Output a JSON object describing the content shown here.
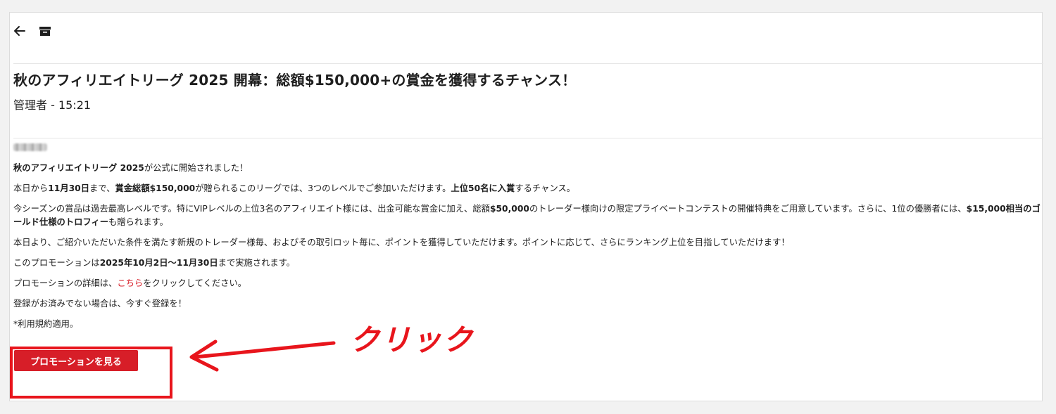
{
  "toolbar": {
    "back_icon": "arrow-left-icon",
    "archive_icon": "archive-box-icon"
  },
  "message": {
    "title": "秋のアフィリエイトリーグ 2025 開幕：総額$150,000+の賞金を獲得するチャンス！",
    "meta": "管理者 - 15:21",
    "paragraphs": {
      "p1_b1": "秋のアフィリエイトリーグ 2025",
      "p1_t1": "が公式に開始されました！",
      "p2_t1": "本日から",
      "p2_b1": "11月30日",
      "p2_t2": "まで、",
      "p2_b2": "賞金総額$150,000",
      "p2_t3": "が贈られるこのリーグでは、3つのレベルでご参加いただけます。",
      "p2_b3": "上位50名に入賞",
      "p2_t4": "するチャンス。",
      "p3_t1": "今シーズンの賞品は過去最高レベルです。特にVIPレベルの上位3名のアフィリエイト様には、出金可能な賞金に加え、総額",
      "p3_b1": "$50,000",
      "p3_t2": "のトレーダー様向けの限定プライベートコンテストの開催特典をご用意しています。さらに、1位の優勝者には、",
      "p3_b2": "$15,000相当のゴールド仕様のトロフィー",
      "p3_t3": "も贈られます。",
      "p4_t1": "本日より、ご紹介いただいた条件を満たす新規のトレーダー様毎、およびその取引ロット毎に、ポイントを獲得していただけます。ポイントに応じて、さらにランキング上位を目指していただけます！",
      "p5_t1": "このプロモーションは",
      "p5_b1": "2025年10月2日〜11月30日",
      "p5_t2": "まで実施されます。",
      "p6_t1": "プロモーションの詳細は、",
      "p6_link": "こちら",
      "p6_t2": "をクリックしてください。",
      "p7_t1": "登録がお済みでない場合は、今すぐ登録を！",
      "p8_t1": "*利用規約適用。"
    },
    "cta_label": "プロモーションを見る"
  },
  "annotation": {
    "label": "クリック",
    "color": "#e8151c"
  },
  "colors": {
    "brand_red": "#d71e28",
    "background": "#f2f2f2",
    "card": "#ffffff"
  }
}
